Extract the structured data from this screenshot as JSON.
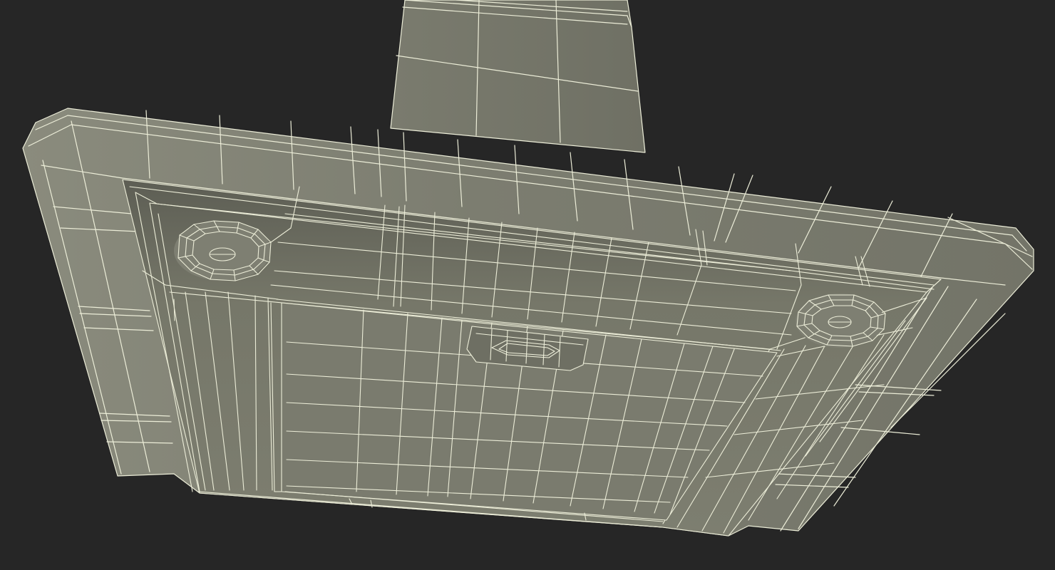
{
  "scene": {
    "subject": "",
    "colors": {
      "background": "#262626",
      "surface": "#7a7b6e",
      "surface_dark": "#5d5e54",
      "surface_light": "#8a8b7d",
      "wire": "#ecedd8"
    }
  }
}
